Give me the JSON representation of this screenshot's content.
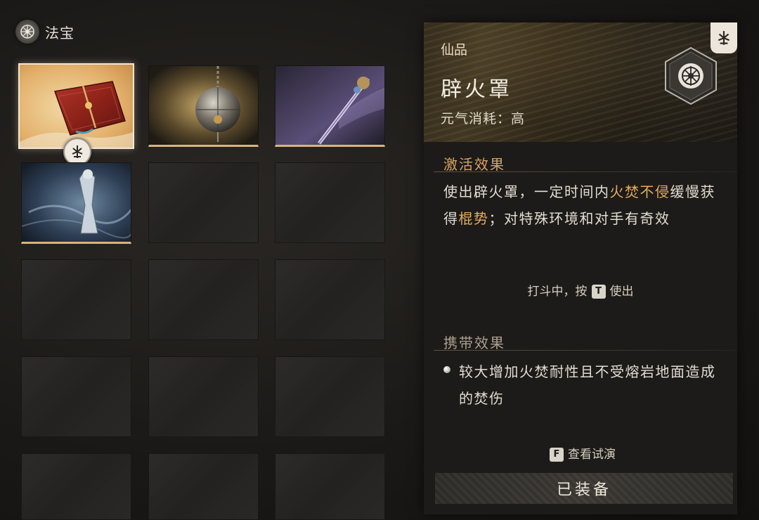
{
  "header": {
    "title": "法宝",
    "icon": "treasure-emblem-icon"
  },
  "grid": {
    "slots": [
      {
        "state": "selected",
        "art": "red-book"
      },
      {
        "state": "filled",
        "art": "silver-orb"
      },
      {
        "state": "filled",
        "art": "jeweled-staff"
      },
      {
        "state": "filled",
        "art": "mist-figure"
      },
      {
        "state": "empty"
      },
      {
        "state": "empty"
      },
      {
        "state": "empty"
      },
      {
        "state": "empty"
      },
      {
        "state": "empty"
      },
      {
        "state": "empty"
      },
      {
        "state": "empty"
      },
      {
        "state": "empty"
      },
      {
        "state": "empty"
      },
      {
        "state": "empty"
      },
      {
        "state": "empty"
      }
    ],
    "equipped_badge_icon": "fire-ward-icon"
  },
  "detail": {
    "tier": "仙品",
    "name": "辟火罩",
    "cost": "元气消耗：高",
    "activation": {
      "title": "激活效果",
      "segments": [
        {
          "text": "使出辟火罩，一定时间内",
          "hl": false
        },
        {
          "text": "火焚不侵",
          "hl": true
        },
        {
          "text": "缓慢获得",
          "hl": false
        },
        {
          "text": "棍势",
          "hl": true
        },
        {
          "text": "；对特殊环境和对手有奇效",
          "hl": false
        }
      ]
    },
    "use_hint": {
      "before": "打斗中，按",
      "key": "T",
      "after": "使出"
    },
    "carry": {
      "title": "携带效果",
      "text": "较大增加火焚耐性且不受熔岩地面造成的焚伤"
    },
    "preview_hint": {
      "key": "F",
      "label": "查看试演"
    },
    "equipped_label": "已装备"
  },
  "colors": {
    "highlight": "#e4ac5e",
    "accent_gold": "#d9b47a"
  }
}
